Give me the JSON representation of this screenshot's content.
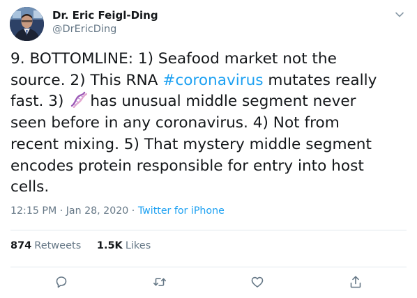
{
  "author": {
    "name": "Dr. Eric Feigl-Ding",
    "handle": "@DrEricDing"
  },
  "tweet": {
    "lines": [
      [
        "9. BOTTOMLINE: 1) Seafood market not the"
      ],
      [
        "source. 2) This RNA ",
        "#coronavirus",
        " mutates really"
      ],
      [
        "fast. 3) ",
        "has unusual middle segment never"
      ],
      [
        "seen before in any coronavirus. 4) Not from"
      ],
      [
        "recent mixing. 5) That mystery middle segment"
      ],
      [
        "encodes protein responsible for entry into host"
      ],
      [
        "cells."
      ]
    ],
    "hashtag": "#coronavirus",
    "emoji_icon": "dna-icon"
  },
  "meta": {
    "time": "12:15 PM",
    "separator": " · ",
    "date": "Jan 28, 2020",
    "source": "Twitter for iPhone"
  },
  "stats": {
    "retweets_count": "874",
    "retweets_label": "Retweets",
    "likes_count": "1.5K",
    "likes_label": "Likes"
  },
  "actions": [
    "reply-icon",
    "retweet-icon",
    "like-icon",
    "share-icon"
  ],
  "colors": {
    "text": "#14171a",
    "secondary": "#657786",
    "link": "#1da1f2",
    "divider": "#e1e8ed"
  }
}
